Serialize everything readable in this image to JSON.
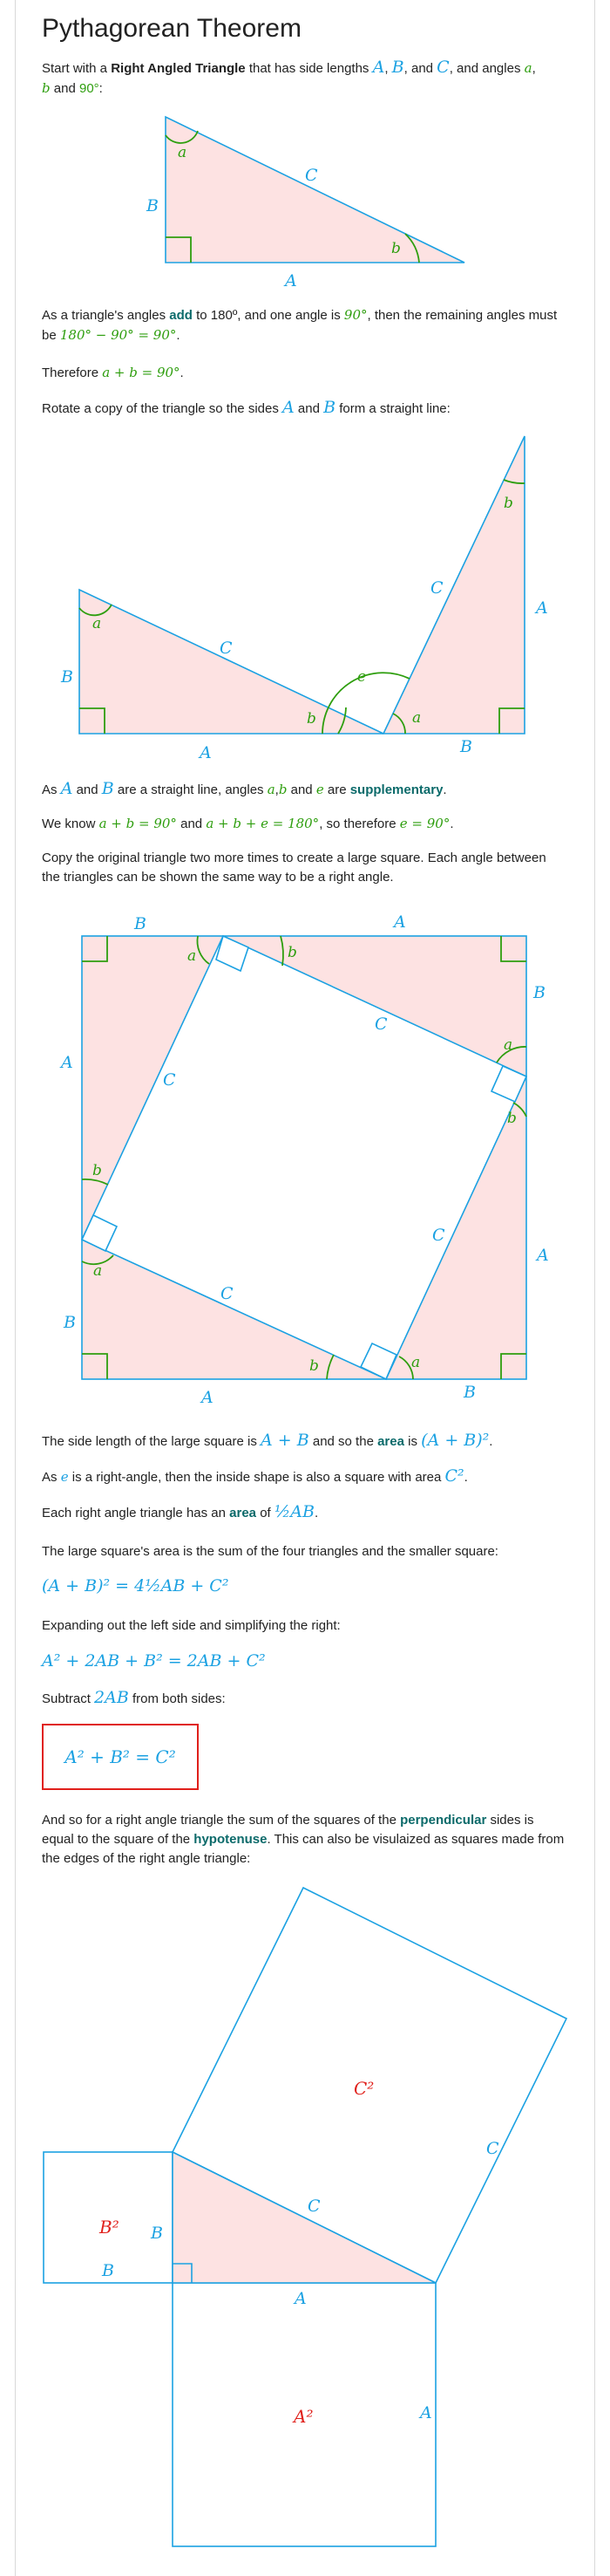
{
  "title": "Pythagorean Theorem",
  "intro": {
    "t1": "Start with a ",
    "kw": "Right Angled Triangle",
    "t2": " that has side lengths ",
    "A": "A",
    "sep1": ", ",
    "B": "B",
    "sep2": ", and ",
    "C": "C",
    "t3": ", and angles ",
    "a": "a",
    "sep3": ",",
    "b": "b",
    "t4": " and ",
    "n90": "90°",
    "t5": ":"
  },
  "labels": {
    "A": "A",
    "B": "B",
    "C": "C",
    "a": "a",
    "b": "b",
    "e": "e",
    "A2": "A²",
    "B2": "B²",
    "C2": "C²"
  },
  "p_angles": {
    "t1": "As a triangle's angles ",
    "kw": "add",
    "t2": " to 180º, and one angle is ",
    "m1": "90°",
    "t3": ", then the remaining angles must be ",
    "m2": "180° − 90° = 90°",
    "t4": "."
  },
  "p_therefore": {
    "t1": "Therefore ",
    "m1": "a + b = 90°",
    "t2": "."
  },
  "p_rotate": {
    "t1": "Rotate a copy of the triangle so the sides ",
    "A": "A",
    "t2": " and ",
    "B": "B",
    "t3": " form a straight line:"
  },
  "p_line": {
    "t1": "As ",
    "A": "A",
    "t2": " and ",
    "B": "B",
    "t3": " are a straight line, angles ",
    "a": "a",
    "c1": ",",
    "b": "b",
    "t4": " and ",
    "e": "e",
    "t5": " are ",
    "kw": "supplementary",
    "t6": "."
  },
  "p_know": {
    "t1": "We know ",
    "m1": "a + b = 90°",
    "t2": " and ",
    "m2": "a + b + e = 180°",
    "t3": ", so therefore ",
    "m3": "e = 90°",
    "t4": "."
  },
  "p_copy": "Copy the original triangle two more times to create a large square. Each angle between the triangles can be shown the same way to be a right angle.",
  "p_side": {
    "t1": "The side length of the large square is ",
    "m1": "A + B",
    "t2": " and so the ",
    "kw": "area",
    "t3": " is ",
    "m2": "(A + B)²",
    "t4": "."
  },
  "p_e": {
    "t1": "As ",
    "m1": "e",
    "t2": " is a right-angle, then the inside shape is also a square with area ",
    "m2": "C²",
    "t3": "."
  },
  "p_each": {
    "t1": "Each right angle triangle has an ",
    "kw": "area",
    "t2": " of ",
    "m1": "½AB",
    "t3": "."
  },
  "p_large": "The large square's area is the sum of the four triangles and the smaller square:",
  "eq1": "(A + B)² = 4½AB + C²",
  "p_expand": "Expanding out the left side and simplifying the right:",
  "eq2": "A² + 2AB + B² = 2AB + C²",
  "p_subtract": {
    "t1": "Subtract ",
    "m1": "2AB",
    "t2": " from both sides:"
  },
  "result": "A² + B² = C²",
  "p_final": {
    "t1": "And so for a right angle triangle the sum of the squares of the ",
    "kw1": "perpendicular",
    "t2": " sides is equal to the square of the ",
    "kw2": "hypotenuse",
    "t3": ". This can also be visulaized as squares made from the edges of the right angle triangle:"
  },
  "colors": {
    "blue": "#1ba1e2",
    "green": "#2e9e0e",
    "red": "#e0201b",
    "pink": "#fde2e2",
    "keyword": "#0b6a6a"
  }
}
